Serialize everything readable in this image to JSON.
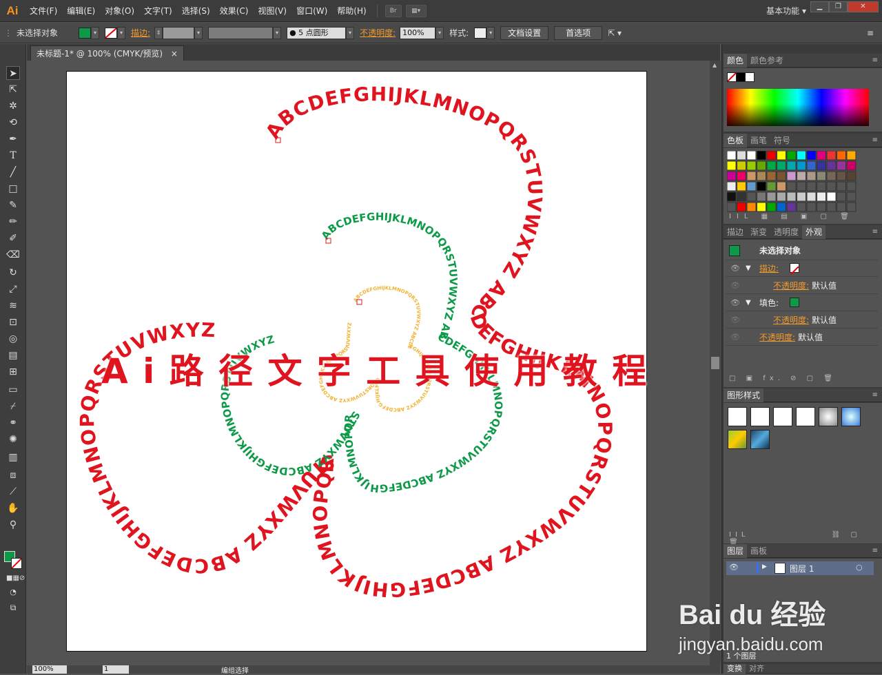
{
  "app": {
    "logo": "Ai"
  },
  "menu": [
    "文件(F)",
    "编辑(E)",
    "对象(O)",
    "文字(T)",
    "选择(S)",
    "效果(C)",
    "视图(V)",
    "窗口(W)",
    "帮助(H)"
  ],
  "menubar": {
    "bridge": "Br",
    "workspace": "基本功能"
  },
  "control": {
    "selection": "未选择对象",
    "stroke_label": "描边:",
    "brush": "5 点圆形",
    "opacity_label": "不透明度:",
    "opacity": "100%",
    "style_label": "样式:",
    "doc_setup": "文档设置",
    "prefs": "首选项"
  },
  "document": {
    "tab": "未标题-1* @ 100% (CMYK/预览)"
  },
  "status": {
    "zoom": "100%",
    "page": "1",
    "tool": "编组选择"
  },
  "artwork": {
    "title": "A i 路 径 文 字 工 具 使 用 教 程",
    "path_text": "ABCDEFGHIJKLMNOPQRSTUVWXYZ ABCDEFGHIJKLMNOPQRSTUVWXYZ ABCDEFGHIJKLMNOPQRSTUVWXYZ ABCDEFGHIJKLMNOPQRSTUVWXYZ",
    "colors": {
      "red": "#e0141e",
      "green": "#0d9a48",
      "yellow": "#f2b12e"
    }
  },
  "panels": {
    "color_tabs": [
      "颜色",
      "颜色参考"
    ],
    "swatch_tabs": [
      "色板",
      "画笔",
      "符号"
    ],
    "appearance_tabs": [
      "描边",
      "渐变",
      "透明度",
      "外观"
    ],
    "appearance": {
      "header": "未选择对象",
      "stroke": "描边:",
      "opacity": "不透明度:",
      "default": "默认值",
      "fill": "填色:"
    },
    "graphic_style_tab": "图形样式",
    "layers_tabs": [
      "图层",
      "画板"
    ],
    "layer_name": "图层 1",
    "layer_count": "1 个图层",
    "bottom_tabs": [
      "变换",
      "对齐"
    ]
  },
  "watermark": {
    "brand": "Bai du 经验",
    "url": "jingyan.baidu.com"
  }
}
